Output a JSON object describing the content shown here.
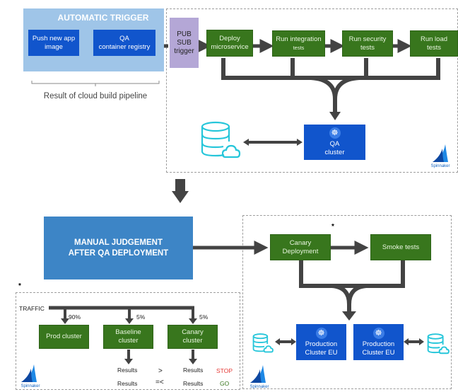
{
  "top": {
    "auto_trigger_title": "AUTOMATIC TRIGGER",
    "push_image": "Push new app image",
    "qa_registry_line1": "QA",
    "qa_registry_line2": "container registry",
    "pipeline_caption": "Result of cloud build pipeline",
    "pubsub": [
      "PUB",
      "SUB",
      "trigger"
    ],
    "stages": [
      {
        "line1": "Deploy",
        "line2": "microservice"
      },
      {
        "line1": "Run integration",
        "line2": "tests"
      },
      {
        "line1": "Run security",
        "line2": "tests"
      },
      {
        "line1": "Run load",
        "line2": "tests"
      }
    ],
    "qa_cluster": {
      "line1": "QA",
      "line2": "cluster"
    },
    "spinnaker_label": "Spinnaker"
  },
  "bottom": {
    "manual_judgement_line1": "MANUAL JUDGEMENT",
    "manual_judgement_line2": "AFTER QA DEPLOYMENT",
    "canary_deployment": {
      "line1": "Canary",
      "line2": "Deployment"
    },
    "smoke_tests": "Smoke tests",
    "asterisk": "*",
    "prod_clusters": [
      {
        "line1": "Production",
        "line2": "Cluster EU"
      },
      {
        "line1": "Production",
        "line2": "Cluster EU"
      }
    ],
    "spinnaker_label": "Spinnaker"
  },
  "canary_detail": {
    "asterisk": "*",
    "traffic_label": "TRAFFIC",
    "splits": [
      "90%",
      "5%",
      "5%"
    ],
    "clusters": [
      {
        "line1": "Prod cluster",
        "line2": ""
      },
      {
        "line1": "Baseline",
        "line2": "cluster"
      },
      {
        "line1": "Canary",
        "line2": "cluster"
      }
    ],
    "results": [
      "Results",
      "Results",
      "Results",
      "Results"
    ],
    "comparators": [
      ">",
      "=<"
    ],
    "outcomes": {
      "stop": "STOP",
      "go": "GO"
    },
    "colors": {
      "stop": "#e53935",
      "go": "#38761d"
    },
    "spinnaker_label": "Spinnaker"
  },
  "colors": {
    "green_stage": "#38761d",
    "blue_cluster": "#1155cc",
    "light_blue_panel": "#9fc5e8",
    "manual_blue": "#3d85c6",
    "pubsub_purple": "#b4a7d6",
    "arrow": "#434343",
    "db_cyan": "#26c6da"
  }
}
